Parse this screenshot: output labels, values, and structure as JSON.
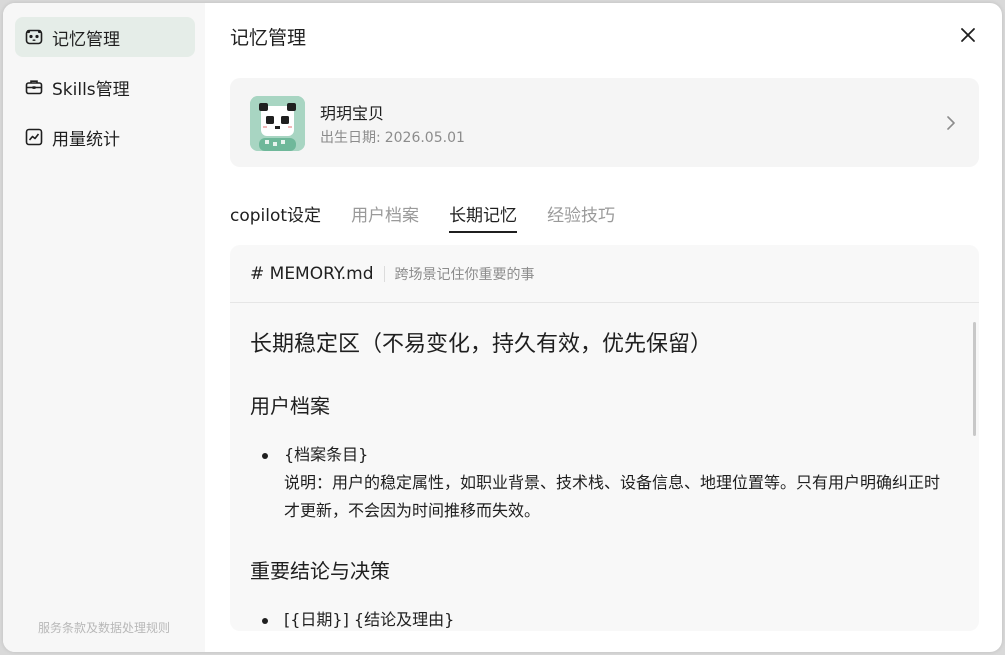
{
  "sidebar": {
    "items": [
      {
        "label": "记忆管理",
        "icon": "panda-icon",
        "active": true
      },
      {
        "label": "Skills管理",
        "icon": "toolbox-icon",
        "active": false
      },
      {
        "label": "用量统计",
        "icon": "chart-icon",
        "active": false
      }
    ],
    "footer": "服务条款及数据处理规则"
  },
  "header": {
    "title": "记忆管理"
  },
  "profile": {
    "name": "玥玥宝贝",
    "birth_label": "出生日期:",
    "birth_value": "2026.05.01"
  },
  "tabs": [
    {
      "label": "copilot设定",
      "active": false
    },
    {
      "label": "用户档案",
      "active": false
    },
    {
      "label": "长期记忆",
      "active": true
    },
    {
      "label": "经验技巧",
      "active": false
    }
  ],
  "document": {
    "filename": "# MEMORY.md",
    "description": "跨场景记住你重要的事",
    "heading": "长期稳定区（不易变化，持久有效，优先保留）",
    "sections": [
      {
        "title": "用户档案",
        "item_title": "{档案条目}",
        "item_desc": "说明：用户的稳定属性，如职业背景、技术栈、设备信息、地理位置等。只有用户明确纠正时才更新，不会因为时间推移而失效。"
      },
      {
        "title": "重要结论与决策",
        "item_title": "[{日期}] {结论及理由}"
      }
    ]
  },
  "colors": {
    "active_nav_bg": "#e5ede8",
    "sidebar_bg": "#f7f7f7",
    "avatar_bg": "#a8d5c2"
  }
}
